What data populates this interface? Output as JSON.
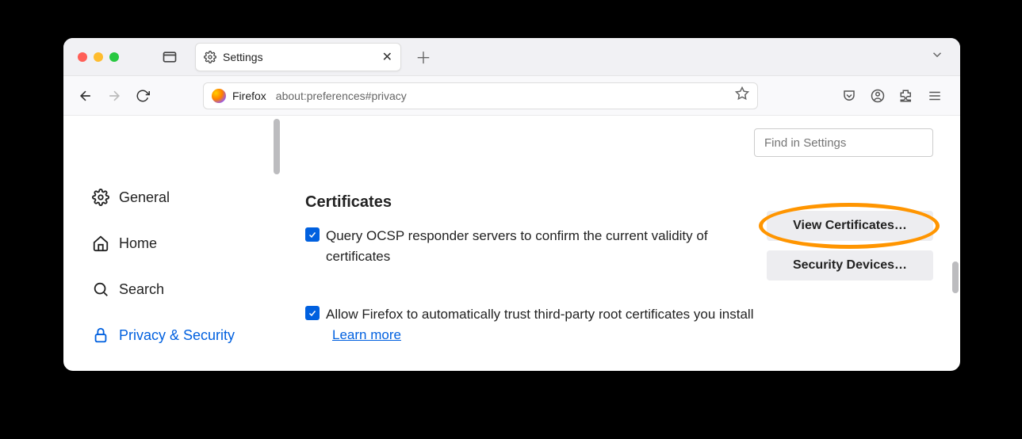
{
  "window": {
    "tab_title": "Settings"
  },
  "urlbar": {
    "context": "Firefox",
    "path": "about:preferences#privacy"
  },
  "find": {
    "placeholder": "Find in Settings"
  },
  "sidebar": {
    "items": [
      {
        "label": "General"
      },
      {
        "label": "Home"
      },
      {
        "label": "Search"
      },
      {
        "label": "Privacy & Security"
      }
    ]
  },
  "section": {
    "title": "Certificates",
    "ocsp_label": "Query OCSP responder servers to confirm the current validity of certificates",
    "ocsp_checked": true,
    "trust_label": "Allow Firefox to automatically trust third-party root certificates you install",
    "trust_checked": true,
    "learn_more": "Learn more"
  },
  "buttons": {
    "view_certs": "View Certificates…",
    "security_devices": "Security Devices…"
  }
}
